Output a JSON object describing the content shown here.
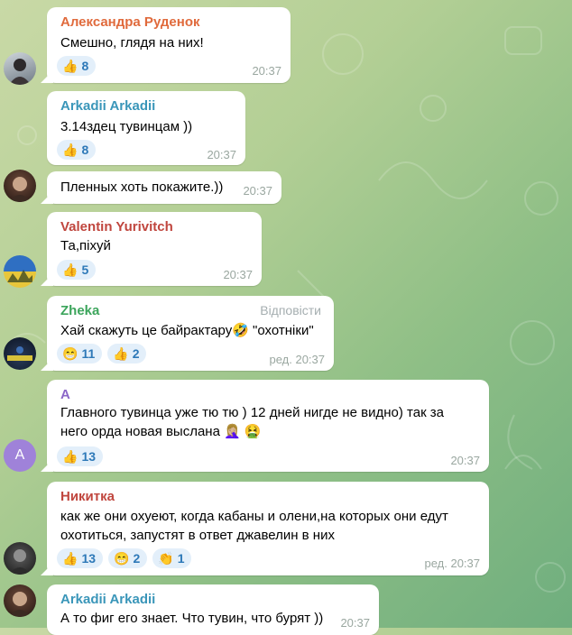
{
  "messages": [
    {
      "sender": "Александра Руденок",
      "sender_color": "#e06a3c",
      "lines": [
        "Смешно, глядя на них!"
      ],
      "reactions": [
        {
          "emoji": "👍",
          "count": "8"
        }
      ],
      "time": "20:37"
    },
    {
      "sender": "Arkadii Arkadii",
      "sender_color": "#3a96b9",
      "lines": [
        "3.14здец тувинцам ))"
      ],
      "reactions": [
        {
          "emoji": "👍",
          "count": "8"
        }
      ],
      "time": "20:37"
    },
    {
      "sender": "",
      "lines": [
        "Пленных хоть покажите.))"
      ],
      "reactions": [],
      "time": "20:37"
    },
    {
      "sender": "Valentin Yurivitch",
      "sender_color": "#c0463e",
      "lines": [
        "Та,піхуй"
      ],
      "reactions": [
        {
          "emoji": "👍",
          "count": "5"
        }
      ],
      "time": "20:37"
    },
    {
      "sender": "Zheka",
      "sender_color": "#3ca55c",
      "reply_label": "Відповісти",
      "lines": [
        "Хай скажуть це байрактару🤣 \"охотніки\""
      ],
      "reactions": [
        {
          "emoji": "😁",
          "count": "11"
        },
        {
          "emoji": "👍",
          "count": "2"
        }
      ],
      "time": "ред. 20:37"
    },
    {
      "sender": "A",
      "sender_color": "#8b66c8",
      "lines": [
        "Главного тувинца уже тю тю ) 12 дней нигде не видно) так за",
        "него орда новая выслана 🤦🏼‍♀️ 🤮"
      ],
      "reactions": [
        {
          "emoji": "👍",
          "count": "13"
        }
      ],
      "time": "20:37",
      "avatar_letter": "A"
    },
    {
      "sender": "Никитка",
      "sender_color": "#c0463e",
      "lines": [
        "как же они охуеют, когда кабаны и олени,на которых они едут",
        "охотиться, запустят в ответ джавелин в них"
      ],
      "reactions": [
        {
          "emoji": "👍",
          "count": "13"
        },
        {
          "emoji": "😁",
          "count": "2"
        },
        {
          "emoji": "👏",
          "count": "1"
        }
      ],
      "time": "ред. 20:37"
    },
    {
      "sender": "Arkadii Arkadii",
      "sender_color": "#3a96b9",
      "lines": [
        "А то фиг его знает. Что тувин, что бурят ))"
      ],
      "reactions": [],
      "time": "20:37"
    }
  ]
}
